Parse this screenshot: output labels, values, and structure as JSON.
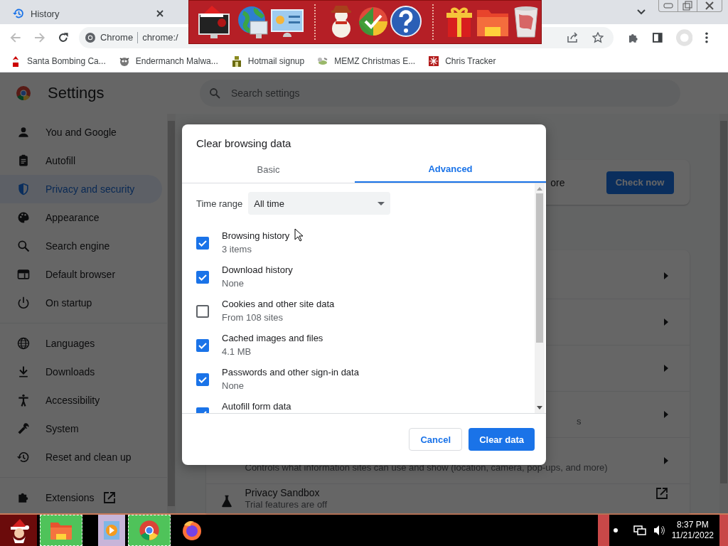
{
  "browser": {
    "tabs": [
      {
        "title": "History",
        "selected": false
      }
    ],
    "address_bar": {
      "site_label": "Chrome",
      "url": "chrome:/"
    },
    "bookmarks": [
      {
        "label": "Santa Bombing Ca..."
      },
      {
        "label": "Endermanch Malwa..."
      },
      {
        "label": "Hotmail signup"
      },
      {
        "label": "MEMZ Christmas E..."
      },
      {
        "label": "Chris Tracker"
      }
    ]
  },
  "settings": {
    "title": "Settings",
    "search": {
      "placeholder": "Search settings"
    },
    "nav": [
      {
        "items": [
          {
            "label": "You and Google",
            "selected": false,
            "external": false
          },
          {
            "label": "Autofill",
            "selected": false,
            "external": false
          },
          {
            "label": "Privacy and security",
            "selected": true,
            "external": false
          },
          {
            "label": "Appearance",
            "selected": false,
            "external": false
          },
          {
            "label": "Search engine",
            "selected": false,
            "external": false
          },
          {
            "label": "Default browser",
            "selected": false,
            "external": false
          },
          {
            "label": "On startup",
            "selected": false,
            "external": false
          }
        ]
      },
      {
        "items": [
          {
            "label": "Languages",
            "selected": false,
            "external": false
          },
          {
            "label": "Downloads",
            "selected": false,
            "external": false
          },
          {
            "label": "Accessibility",
            "selected": false,
            "external": false
          },
          {
            "label": "System",
            "selected": false,
            "external": false
          },
          {
            "label": "Reset and clean up",
            "selected": false,
            "external": false
          }
        ]
      },
      {
        "items": [
          {
            "label": "Extensions",
            "selected": false,
            "external": true
          }
        ]
      }
    ],
    "safety_card": {
      "text": "ore",
      "button": "Check now"
    },
    "rows": [
      {
        "kind": "subpage"
      },
      {
        "kind": "subpage"
      },
      {
        "kind": "subpage"
      },
      {
        "kind": "subpage",
        "detail": "s"
      },
      {
        "kind": "subpage",
        "detail": "Controls what information sites can use and show (location, camera, pop-ups, and more)"
      },
      {
        "kind": "external",
        "title": "Privacy Sandbox",
        "detail": "Trial features are off"
      }
    ]
  },
  "dialog": {
    "title": "Clear browsing data",
    "tabs": [
      {
        "label": "Basic",
        "selected": false
      },
      {
        "label": "Advanced",
        "selected": true
      }
    ],
    "time_range": {
      "label": "Time range",
      "value": "All time"
    },
    "items": [
      {
        "title": "Browsing history",
        "detail": "3 items",
        "checked": true
      },
      {
        "title": "Download history",
        "detail": "None",
        "checked": true
      },
      {
        "title": "Cookies and other site data",
        "detail": "From 108 sites",
        "checked": false
      },
      {
        "title": "Cached images and files",
        "detail": "4.1 MB",
        "checked": true
      },
      {
        "title": "Passwords and other sign-in data",
        "detail": "None",
        "checked": true
      },
      {
        "title": "Autofill form data",
        "checked": true
      }
    ],
    "buttons": [
      {
        "label": "Cancel",
        "kind": "secondary"
      },
      {
        "label": "Clear data",
        "kind": "primary"
      }
    ]
  },
  "taskbar": {
    "time": "8:37 PM",
    "date": "11/21/2022"
  }
}
